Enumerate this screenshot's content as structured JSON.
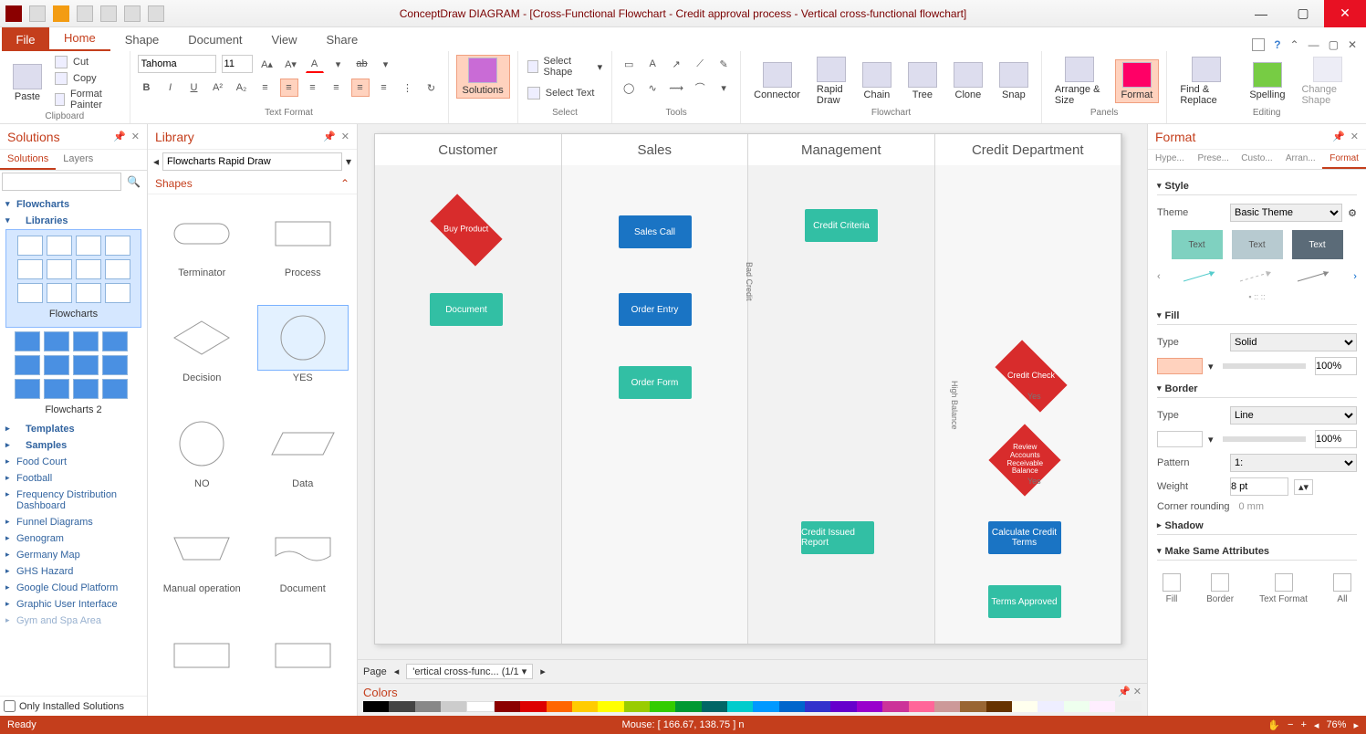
{
  "title": "ConceptDraw DIAGRAM - [Cross-Functional Flowchart - Credit approval process - Vertical cross-functional flowchart]",
  "menu": {
    "file": "File",
    "tabs": [
      "Home",
      "Shape",
      "Document",
      "View",
      "Share"
    ],
    "active": 0
  },
  "ribbon": {
    "clipboard": {
      "paste": "Paste",
      "cut": "Cut",
      "copy": "Copy",
      "fp": "Format Painter",
      "label": "Clipboard"
    },
    "textfmt": {
      "font": "Tahoma",
      "size": "11",
      "label": "Text Format"
    },
    "solutions": {
      "btn": "Solutions"
    },
    "select": {
      "shape": "Select Shape",
      "text": "Select Text",
      "label": "Select"
    },
    "tools": {
      "label": "Tools"
    },
    "flowchart": {
      "connector": "Connector",
      "rapid": "Rapid Draw",
      "chain": "Chain",
      "tree": "Tree",
      "clone": "Clone",
      "snap": "Snap",
      "label": "Flowchart"
    },
    "panels": {
      "arrange": "Arrange & Size",
      "format": "Format",
      "label": "Panels"
    },
    "editing": {
      "find": "Find & Replace",
      "spelling": "Spelling",
      "change": "Change Shape",
      "label": "Editing"
    }
  },
  "solutionsPanel": {
    "title": "Solutions",
    "tabs": [
      "Solutions",
      "Layers"
    ],
    "search": "",
    "tree_flowcharts": "Flowcharts",
    "tree_libraries": "Libraries",
    "grid1_label": "Flowcharts",
    "grid2_label": "Flowcharts 2",
    "tree_templates": "Templates",
    "tree_samples": "Samples",
    "items": [
      "Food Court",
      "Football",
      "Frequency Distribution Dashboard",
      "Funnel Diagrams",
      "Genogram",
      "Germany Map",
      "GHS Hazard",
      "Google Cloud Platform",
      "Graphic User Interface",
      "Gym and Spa Area"
    ],
    "only_installed": "Only Installed Solutions"
  },
  "libraryPanel": {
    "title": "Library",
    "selector": "Flowcharts Rapid Draw",
    "shapes_h": "Shapes",
    "shapes": [
      {
        "n": "Terminator"
      },
      {
        "n": "Process"
      },
      {
        "n": "Decision"
      },
      {
        "n": "YES"
      },
      {
        "n": "NO"
      },
      {
        "n": "Data"
      },
      {
        "n": "Manual operation"
      },
      {
        "n": "Document"
      }
    ],
    "selected_index": 3
  },
  "canvas": {
    "lanes": [
      "Customer",
      "Sales",
      "Management",
      "Credit Department"
    ],
    "shapes": {
      "buy": "Buy Product",
      "sales_call": "Sales Call",
      "credit_criteria": "Credit Criteria",
      "document": "Document",
      "order_entry": "Order Entry",
      "order_form": "Order Form",
      "credit_check": "Credit Check",
      "review": "Review Accounts Receivable Balance",
      "calc": "Calculate Credit Terms",
      "issued": "Credit Issued Report",
      "approved": "Terms Approved",
      "bad_credit": "Bad Credit",
      "high_balance": "High Balance",
      "yes1": "Yes",
      "yes2": "Yes"
    },
    "page_label": "Page",
    "page_select": "'ertical cross-func... (1/1"
  },
  "colorsPanel": {
    "title": "Colors"
  },
  "formatPanel": {
    "title": "Format",
    "tabs": [
      "Hype...",
      "Prese...",
      "Custo...",
      "Arran...",
      "Format"
    ],
    "active": 4,
    "style": {
      "h": "Style",
      "theme_l": "Theme",
      "theme_v": "Basic Theme",
      "sw": [
        "Text",
        "Text",
        "Text"
      ]
    },
    "fill": {
      "h": "Fill",
      "type_l": "Type",
      "type_v": "Solid",
      "opacity": "100%"
    },
    "border": {
      "h": "Border",
      "type_l": "Type",
      "type_v": "Line",
      "opacity": "100%",
      "pattern_l": "Pattern",
      "pattern_v": "1:",
      "weight_l": "Weight",
      "weight_v": "8 pt",
      "corner_l": "Corner rounding",
      "corner_v": "0 mm"
    },
    "shadow": {
      "h": "Shadow"
    },
    "msa": {
      "h": "Make Same Attributes",
      "items": [
        "Fill",
        "Border",
        "Text Format",
        "All"
      ]
    }
  },
  "status": {
    "ready": "Ready",
    "mouse": "Mouse: [ 166.67, 138.75 ] n",
    "zoom": "76%"
  }
}
